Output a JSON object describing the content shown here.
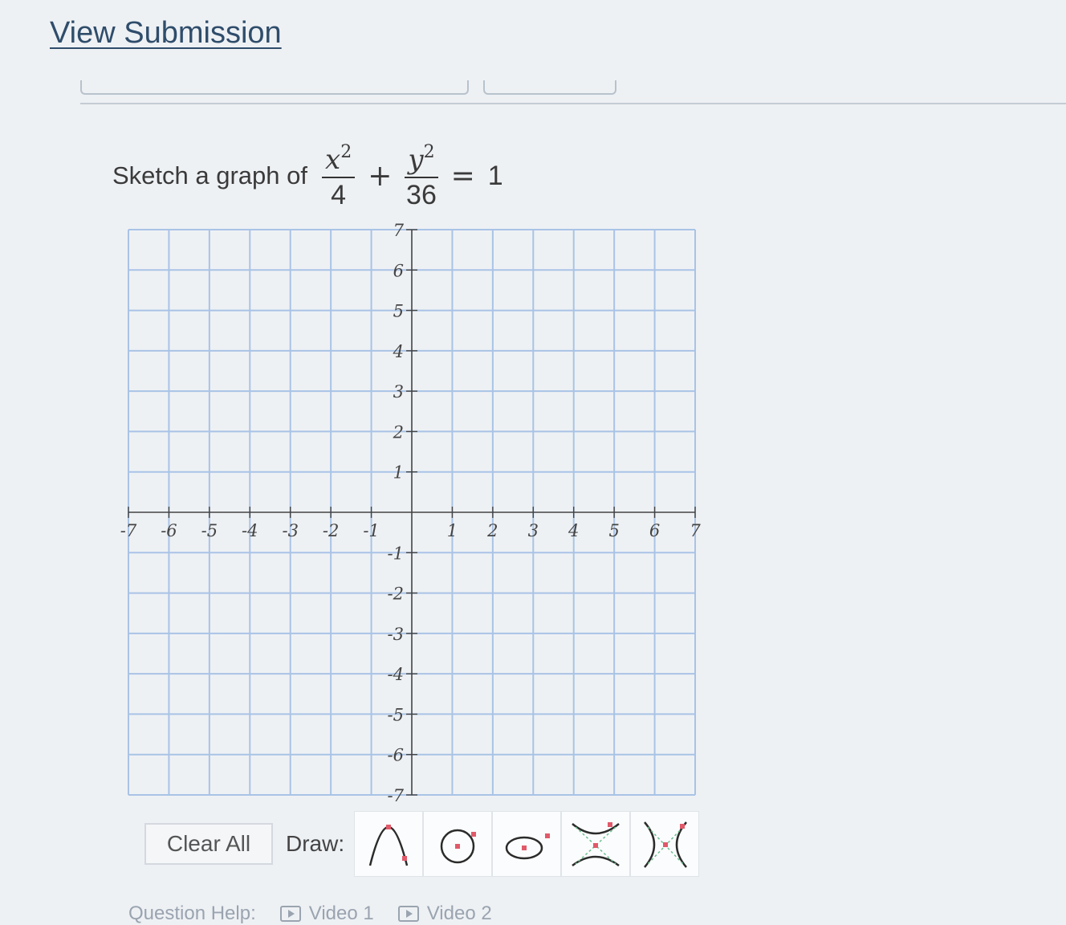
{
  "header": {
    "view_submission": "View Submission"
  },
  "question": {
    "prompt": "Sketch a graph of",
    "term1": {
      "numerator": "x",
      "exponent": "2",
      "denominator": "4"
    },
    "plus": "+",
    "term2": {
      "numerator": "y",
      "exponent": "2",
      "denominator": "36"
    },
    "equals": "=",
    "rhs": "1"
  },
  "chart_data": {
    "type": "scatter",
    "title": "",
    "xlabel": "",
    "ylabel": "",
    "xlim": [
      -7,
      7
    ],
    "ylim": [
      -7,
      7
    ],
    "grid": true,
    "x_ticks": [
      "-7",
      "-6",
      "-5",
      "-4",
      "-3",
      "-2",
      "-1",
      "1",
      "2",
      "3",
      "4",
      "5",
      "6",
      "7"
    ],
    "y_ticks": [
      "7",
      "6",
      "5",
      "4",
      "3",
      "2",
      "1",
      "-1",
      "-2",
      "-3",
      "-4",
      "-5",
      "-6",
      "-7"
    ],
    "series": []
  },
  "toolbar": {
    "clear_all": "Clear All",
    "draw_label": "Draw:",
    "tools": [
      "parabola-tool-icon",
      "circle-tool-icon",
      "ellipse-tool-icon",
      "vertical-hyperbola-tool-icon",
      "horizontal-hyperbola-tool-icon"
    ]
  },
  "help": {
    "label": "Question Help:",
    "video1": "Video 1",
    "video2": "Video 2"
  },
  "colors": {
    "grid": "#a9c3e6",
    "axis": "#444444",
    "link": "#2f4d6b",
    "tool_point": "#e05a6a"
  }
}
